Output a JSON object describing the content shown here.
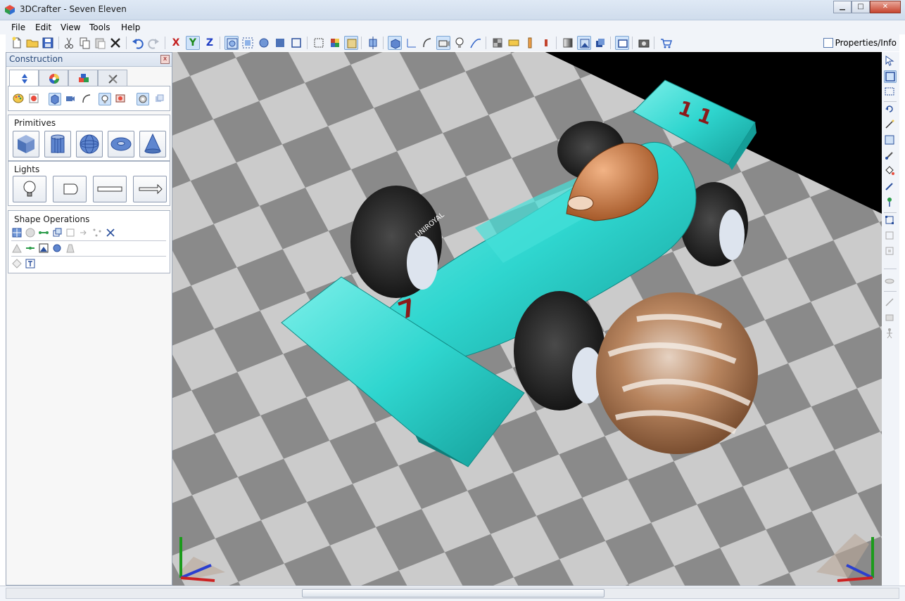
{
  "window": {
    "title": "3DCrafter - Seven Eleven",
    "buttons": [
      "minimize",
      "maximize",
      "close"
    ]
  },
  "menu": [
    {
      "label": "File",
      "underline": "F"
    },
    {
      "label": "Edit",
      "underline": "E"
    },
    {
      "label": "View",
      "underline": "V"
    },
    {
      "label": "Tools",
      "underline": "T"
    },
    {
      "label": "Help",
      "underline": "H"
    }
  ],
  "toolbar": {
    "axis_x": "X",
    "axis_y": "Y",
    "axis_z": "Z",
    "properties_label": "Properties/Info"
  },
  "panel": {
    "title": "Construction",
    "close": "x",
    "tabs": [
      "construction-tab",
      "color-tab",
      "material-tab",
      "tools-tab"
    ],
    "primitives_title": "Primitives",
    "primitives": [
      "cube",
      "cylinder",
      "sphere",
      "torus",
      "cone"
    ],
    "lights_title": "Lights",
    "lights": [
      "point-light",
      "spot-light",
      "linear-light",
      "directional-light"
    ],
    "shape_ops_title": "Shape Operations"
  },
  "viewport": {
    "car_number_nose": "7",
    "car_number_wing": "1 1",
    "tire_text": "UNIROYAL",
    "colors": {
      "car_body": "#2fd6cf",
      "floor_light": "#cccccc",
      "floor_dark": "#8a8a8a",
      "background": "#000000",
      "sphere": "#b8855f"
    }
  }
}
